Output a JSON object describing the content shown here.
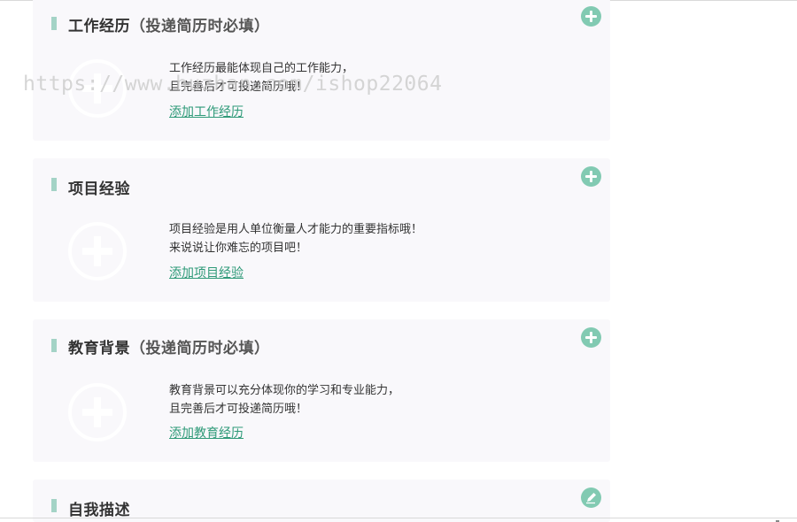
{
  "sections": [
    {
      "title": "工作经历",
      "subtitle": "（投递简历时必填）",
      "desc_lines": [
        "工作经历最能体现自己的工作能力，",
        "且完善后才可投递简历哦！"
      ],
      "link": "添加工作经历",
      "action_icon": "plus-circle-icon"
    },
    {
      "title": "项目经验",
      "subtitle": "",
      "desc_lines": [
        "项目经验是用人单位衡量人才能力的重要指标哦！",
        "来说说让你难忘的项目吧！"
      ],
      "link": "添加项目经验",
      "action_icon": "plus-circle-icon"
    },
    {
      "title": "教育背景",
      "subtitle": "（投递简历时必填）",
      "desc_lines": [
        "教育背景可以充分体现你的学习和专业能力，",
        "且完善后才可投递简历哦！"
      ],
      "link": "添加教育经历",
      "action_icon": "plus-circle-icon"
    },
    {
      "title": "自我描述",
      "subtitle": "",
      "action_icon": "pencil-circle-icon"
    }
  ],
  "watermark": "https://www.huzhan.com/ishop22064",
  "colors": {
    "accent": "#82cab2",
    "link": "#2e9a78",
    "card_bg": "#f9f8fb",
    "bar": "#a4d3c6"
  }
}
